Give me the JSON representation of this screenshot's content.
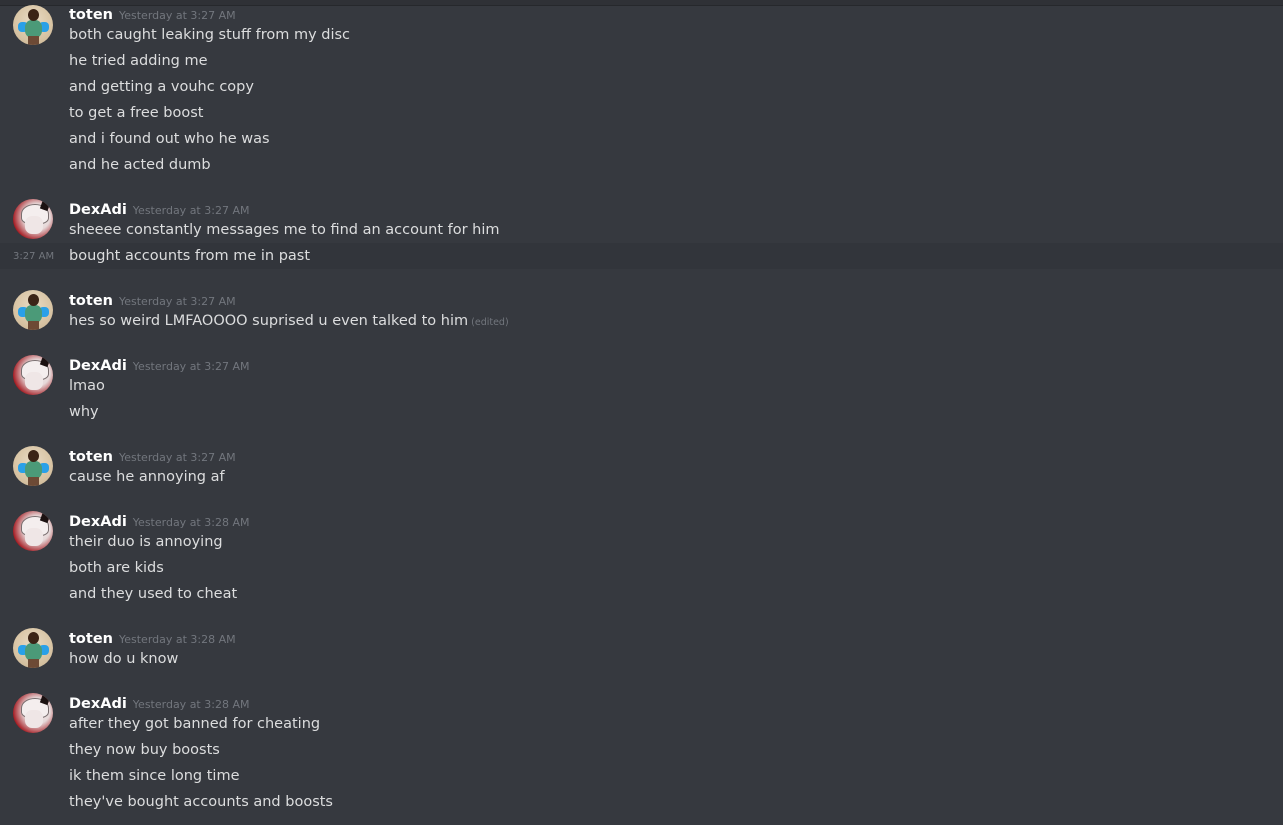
{
  "channel": {
    "messages": [
      {
        "author": "toten",
        "timestamp": "Yesterday at 3:27 AM",
        "lines": [
          "both caught leaking stuff from my disc",
          "he tried adding me",
          "and getting a vouhc copy",
          "to get a free boost",
          "and i found out who he was",
          "and he acted dumb"
        ]
      },
      {
        "author": "DexAdi",
        "timestamp": "Yesterday at 3:27 AM",
        "lines": [
          "sheeee constantly messages me to find an account for him",
          "bought accounts from me in past"
        ],
        "hover_time": "3:27 AM"
      },
      {
        "author": "toten",
        "timestamp": "Yesterday at 3:27 AM",
        "lines": [
          "hes so weird LMFAOOOO suprised u even talked to him"
        ],
        "edited_label": "(edited)"
      },
      {
        "author": "DexAdi",
        "timestamp": "Yesterday at 3:27 AM",
        "lines": [
          "lmao",
          "why"
        ]
      },
      {
        "author": "toten",
        "timestamp": "Yesterday at 3:27 AM",
        "lines": [
          "cause he annoying af"
        ]
      },
      {
        "author": "DexAdi",
        "timestamp": "Yesterday at 3:28 AM",
        "lines": [
          "their duo is annoying",
          "both are kids",
          "and they used to cheat"
        ]
      },
      {
        "author": "toten",
        "timestamp": "Yesterday at 3:28 AM",
        "lines": [
          "how do u know"
        ]
      },
      {
        "author": "DexAdi",
        "timestamp": "Yesterday at 3:28 AM",
        "lines": [
          "after they got banned for cheating",
          "they now buy boosts",
          "ik them since long time",
          "they've bought accounts and boosts"
        ]
      }
    ]
  },
  "colors": {
    "background": "#36393f",
    "username": "#ffffff",
    "text": "#dcddde",
    "muted": "#72767d"
  }
}
